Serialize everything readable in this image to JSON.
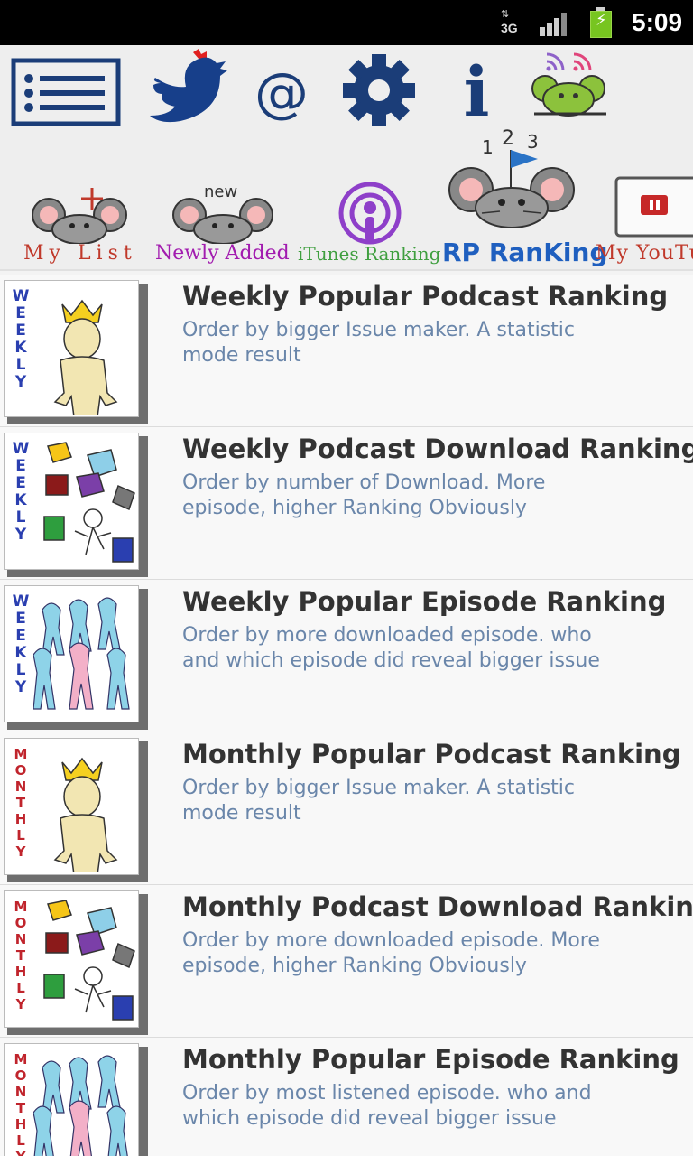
{
  "status_bar": {
    "network": "3G",
    "time": "5:09"
  },
  "toolbar": {
    "top_icons": [
      "list-icon",
      "twitter-bird-icon",
      "at-sign-icon",
      "gear-icon",
      "info-icon",
      "rss-mouse-icon"
    ],
    "info_glyph": "i",
    "at_glyph": "@",
    "nav": [
      {
        "label": "My List",
        "color": "#c0392b",
        "icon": "mouse-plus-icon",
        "badge": "+"
      },
      {
        "label": "Newly Added",
        "color": "#a21caf",
        "icon": "mouse-new-icon",
        "badge": "new"
      },
      {
        "label": "iTunes Ranking",
        "color": "#3f9f3f",
        "icon": "podcast-icon"
      },
      {
        "label": "RP RanKing",
        "color": "#1f5fbf",
        "icon": "mouse-flag-icon",
        "badge": "1 2 3"
      },
      {
        "label": "My YouTu",
        "color": "#c0392b",
        "icon": "youtube-icon"
      }
    ]
  },
  "rankings": [
    {
      "title": "Weekly Popular Podcast Ranking",
      "desc": "Order by bigger Issue maker. A statistic mode result",
      "period": "WEEKLY",
      "period_color": "#2a3fb0",
      "art": "king"
    },
    {
      "title": "Weekly Podcast Download Ranking",
      "desc": "Order by number of Download. More episode, higher Ranking Obviously",
      "period": "WEEKLY",
      "period_color": "#2a3fb0",
      "art": "boxes"
    },
    {
      "title": "Weekly Popular Episode Ranking",
      "desc": "Order by more downloaded episode. who and which episode did reveal bigger issue",
      "period": "WEEKLY",
      "period_color": "#2a3fb0",
      "art": "crowd"
    },
    {
      "title": "Monthly Popular Podcast Ranking",
      "desc": "Order by bigger Issue maker. A statistic mode result",
      "period": "MONTHLY",
      "period_color": "#c0242c",
      "art": "king"
    },
    {
      "title": "Monthly Podcast Download Ranking",
      "desc": "Order by more downloaded episode. More episode, higher Ranking Obviously",
      "period": "MONTHLY",
      "period_color": "#c0242c",
      "art": "boxes"
    },
    {
      "title": "Monthly Popular Episode Ranking",
      "desc": "Order by most listened episode. who and which episode did reveal bigger issue",
      "period": "MONTHLY",
      "period_color": "#c0242c",
      "art": "crowd"
    }
  ]
}
